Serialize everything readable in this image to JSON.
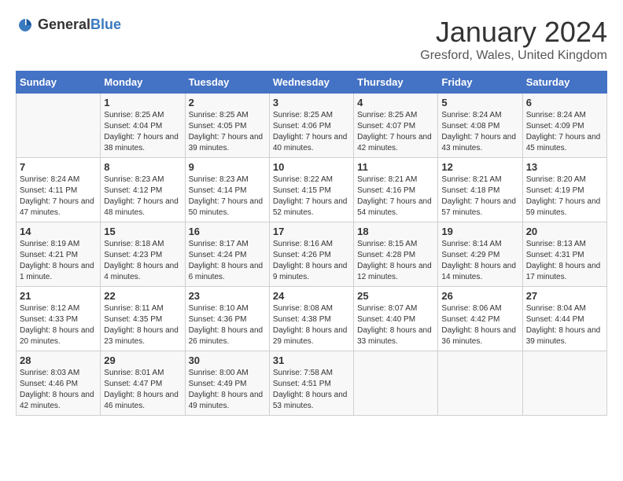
{
  "header": {
    "logo_general": "General",
    "logo_blue": "Blue",
    "month": "January 2024",
    "location": "Gresford, Wales, United Kingdom"
  },
  "days_of_week": [
    "Sunday",
    "Monday",
    "Tuesday",
    "Wednesday",
    "Thursday",
    "Friday",
    "Saturday"
  ],
  "weeks": [
    [
      {
        "day": "",
        "sunrise": "",
        "sunset": "",
        "daylight": ""
      },
      {
        "day": "1",
        "sunrise": "Sunrise: 8:25 AM",
        "sunset": "Sunset: 4:04 PM",
        "daylight": "Daylight: 7 hours and 38 minutes."
      },
      {
        "day": "2",
        "sunrise": "Sunrise: 8:25 AM",
        "sunset": "Sunset: 4:05 PM",
        "daylight": "Daylight: 7 hours and 39 minutes."
      },
      {
        "day": "3",
        "sunrise": "Sunrise: 8:25 AM",
        "sunset": "Sunset: 4:06 PM",
        "daylight": "Daylight: 7 hours and 40 minutes."
      },
      {
        "day": "4",
        "sunrise": "Sunrise: 8:25 AM",
        "sunset": "Sunset: 4:07 PM",
        "daylight": "Daylight: 7 hours and 42 minutes."
      },
      {
        "day": "5",
        "sunrise": "Sunrise: 8:24 AM",
        "sunset": "Sunset: 4:08 PM",
        "daylight": "Daylight: 7 hours and 43 minutes."
      },
      {
        "day": "6",
        "sunrise": "Sunrise: 8:24 AM",
        "sunset": "Sunset: 4:09 PM",
        "daylight": "Daylight: 7 hours and 45 minutes."
      }
    ],
    [
      {
        "day": "7",
        "sunrise": "Sunrise: 8:24 AM",
        "sunset": "Sunset: 4:11 PM",
        "daylight": "Daylight: 7 hours and 47 minutes."
      },
      {
        "day": "8",
        "sunrise": "Sunrise: 8:23 AM",
        "sunset": "Sunset: 4:12 PM",
        "daylight": "Daylight: 7 hours and 48 minutes."
      },
      {
        "day": "9",
        "sunrise": "Sunrise: 8:23 AM",
        "sunset": "Sunset: 4:14 PM",
        "daylight": "Daylight: 7 hours and 50 minutes."
      },
      {
        "day": "10",
        "sunrise": "Sunrise: 8:22 AM",
        "sunset": "Sunset: 4:15 PM",
        "daylight": "Daylight: 7 hours and 52 minutes."
      },
      {
        "day": "11",
        "sunrise": "Sunrise: 8:21 AM",
        "sunset": "Sunset: 4:16 PM",
        "daylight": "Daylight: 7 hours and 54 minutes."
      },
      {
        "day": "12",
        "sunrise": "Sunrise: 8:21 AM",
        "sunset": "Sunset: 4:18 PM",
        "daylight": "Daylight: 7 hours and 57 minutes."
      },
      {
        "day": "13",
        "sunrise": "Sunrise: 8:20 AM",
        "sunset": "Sunset: 4:19 PM",
        "daylight": "Daylight: 7 hours and 59 minutes."
      }
    ],
    [
      {
        "day": "14",
        "sunrise": "Sunrise: 8:19 AM",
        "sunset": "Sunset: 4:21 PM",
        "daylight": "Daylight: 8 hours and 1 minute."
      },
      {
        "day": "15",
        "sunrise": "Sunrise: 8:18 AM",
        "sunset": "Sunset: 4:23 PM",
        "daylight": "Daylight: 8 hours and 4 minutes."
      },
      {
        "day": "16",
        "sunrise": "Sunrise: 8:17 AM",
        "sunset": "Sunset: 4:24 PM",
        "daylight": "Daylight: 8 hours and 6 minutes."
      },
      {
        "day": "17",
        "sunrise": "Sunrise: 8:16 AM",
        "sunset": "Sunset: 4:26 PM",
        "daylight": "Daylight: 8 hours and 9 minutes."
      },
      {
        "day": "18",
        "sunrise": "Sunrise: 8:15 AM",
        "sunset": "Sunset: 4:28 PM",
        "daylight": "Daylight: 8 hours and 12 minutes."
      },
      {
        "day": "19",
        "sunrise": "Sunrise: 8:14 AM",
        "sunset": "Sunset: 4:29 PM",
        "daylight": "Daylight: 8 hours and 14 minutes."
      },
      {
        "day": "20",
        "sunrise": "Sunrise: 8:13 AM",
        "sunset": "Sunset: 4:31 PM",
        "daylight": "Daylight: 8 hours and 17 minutes."
      }
    ],
    [
      {
        "day": "21",
        "sunrise": "Sunrise: 8:12 AM",
        "sunset": "Sunset: 4:33 PM",
        "daylight": "Daylight: 8 hours and 20 minutes."
      },
      {
        "day": "22",
        "sunrise": "Sunrise: 8:11 AM",
        "sunset": "Sunset: 4:35 PM",
        "daylight": "Daylight: 8 hours and 23 minutes."
      },
      {
        "day": "23",
        "sunrise": "Sunrise: 8:10 AM",
        "sunset": "Sunset: 4:36 PM",
        "daylight": "Daylight: 8 hours and 26 minutes."
      },
      {
        "day": "24",
        "sunrise": "Sunrise: 8:08 AM",
        "sunset": "Sunset: 4:38 PM",
        "daylight": "Daylight: 8 hours and 29 minutes."
      },
      {
        "day": "25",
        "sunrise": "Sunrise: 8:07 AM",
        "sunset": "Sunset: 4:40 PM",
        "daylight": "Daylight: 8 hours and 33 minutes."
      },
      {
        "day": "26",
        "sunrise": "Sunrise: 8:06 AM",
        "sunset": "Sunset: 4:42 PM",
        "daylight": "Daylight: 8 hours and 36 minutes."
      },
      {
        "day": "27",
        "sunrise": "Sunrise: 8:04 AM",
        "sunset": "Sunset: 4:44 PM",
        "daylight": "Daylight: 8 hours and 39 minutes."
      }
    ],
    [
      {
        "day": "28",
        "sunrise": "Sunrise: 8:03 AM",
        "sunset": "Sunset: 4:46 PM",
        "daylight": "Daylight: 8 hours and 42 minutes."
      },
      {
        "day": "29",
        "sunrise": "Sunrise: 8:01 AM",
        "sunset": "Sunset: 4:47 PM",
        "daylight": "Daylight: 8 hours and 46 minutes."
      },
      {
        "day": "30",
        "sunrise": "Sunrise: 8:00 AM",
        "sunset": "Sunset: 4:49 PM",
        "daylight": "Daylight: 8 hours and 49 minutes."
      },
      {
        "day": "31",
        "sunrise": "Sunrise: 7:58 AM",
        "sunset": "Sunset: 4:51 PM",
        "daylight": "Daylight: 8 hours and 53 minutes."
      },
      {
        "day": "",
        "sunrise": "",
        "sunset": "",
        "daylight": ""
      },
      {
        "day": "",
        "sunrise": "",
        "sunset": "",
        "daylight": ""
      },
      {
        "day": "",
        "sunrise": "",
        "sunset": "",
        "daylight": ""
      }
    ]
  ]
}
